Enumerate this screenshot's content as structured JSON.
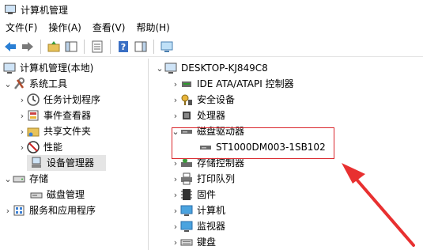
{
  "window": {
    "title": "计算机管理"
  },
  "menu": [
    "文件(F)",
    "操作(A)",
    "查看(V)",
    "帮助(H)"
  ],
  "toolbar": {
    "icons": [
      "back-arrow-icon",
      "forward-arrow-icon",
      "folder-up-icon",
      "show-hide-tree-icon",
      "properties-icon",
      "help-icon",
      "action-pane-icon",
      "monitor-icon"
    ]
  },
  "left_tree": [
    {
      "label": "计算机管理(本地)",
      "icon": "computer-management-icon"
    },
    {
      "label": "系统工具",
      "icon": "system-tools-icon"
    },
    {
      "label": "任务计划程序",
      "icon": "clock-icon"
    },
    {
      "label": "事件查看器",
      "icon": "event-viewer-icon"
    },
    {
      "label": "共享文件夹",
      "icon": "shared-folder-icon"
    },
    {
      "label": "性能",
      "icon": "performance-icon"
    },
    {
      "label": "设备管理器",
      "icon": "device-manager-icon"
    },
    {
      "label": "存储",
      "icon": "storage-icon"
    },
    {
      "label": "磁盘管理",
      "icon": "disk-management-icon"
    },
    {
      "label": "服务和应用程序",
      "icon": "services-icon"
    }
  ],
  "right_tree": [
    {
      "label": "DESKTOP-KJ849C8",
      "icon": "computer-icon"
    },
    {
      "label": "IDE ATA/ATAPI 控制器",
      "icon": "ide-controller-icon"
    },
    {
      "label": "安全设备",
      "icon": "security-device-icon"
    },
    {
      "label": "处理器",
      "icon": "processor-icon"
    },
    {
      "label": "磁盘驱动器",
      "icon": "disk-drive-icon"
    },
    {
      "label": "ST1000DM003-1SB102",
      "icon": "hard-disk-icon"
    },
    {
      "label": "存储控制器",
      "icon": "storage-controller-icon"
    },
    {
      "label": "打印队列",
      "icon": "printer-icon"
    },
    {
      "label": "固件",
      "icon": "firmware-icon"
    },
    {
      "label": "计算机",
      "icon": "monitor-icon"
    },
    {
      "label": "监视器",
      "icon": "display-icon"
    },
    {
      "label": "键盘",
      "icon": "keyboard-icon"
    }
  ],
  "colors": {
    "highlight": "#d9262b",
    "selected_bg": "#e5e5e5"
  }
}
